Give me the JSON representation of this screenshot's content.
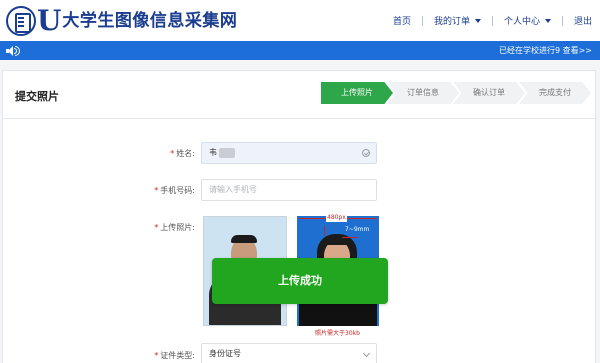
{
  "header": {
    "logo_letter": "U",
    "site_name": "大学生图像信息采集网",
    "nav": {
      "home": "首页",
      "my_orders": "我的订单",
      "user_center": "个人中心",
      "logout": "退出"
    }
  },
  "notice": {
    "text": "已经在学校进行9 查看>>"
  },
  "page": {
    "title": "提交照片"
  },
  "steps": [
    {
      "label": "上传照片",
      "active": true
    },
    {
      "label": "订单信息",
      "active": false
    },
    {
      "label": "确认订单",
      "active": false
    },
    {
      "label": "完成支付",
      "active": false
    }
  ],
  "form": {
    "name": {
      "label": "姓名:",
      "required_mark": "*",
      "value": "韦"
    },
    "phone": {
      "label": "手机号码:",
      "required_mark": "*",
      "placeholder": "请输入手机号"
    },
    "photo": {
      "label": "上传照片:",
      "required_mark": "*"
    },
    "id_type": {
      "label": "证件类型:",
      "required_mark": "*",
      "value": "身份证号"
    }
  },
  "photo_spec": {
    "width_label": "480px",
    "margin_label": "7~9mm",
    "size_note": "照片需大于30kb"
  },
  "upload_success_label": "上传成功",
  "colors": {
    "brand_blue": "#1b3d8f",
    "notice_blue": "#1d6ed8",
    "step_green": "#2ea64a",
    "success_green": "#22a61f",
    "required_red": "#e02020"
  }
}
